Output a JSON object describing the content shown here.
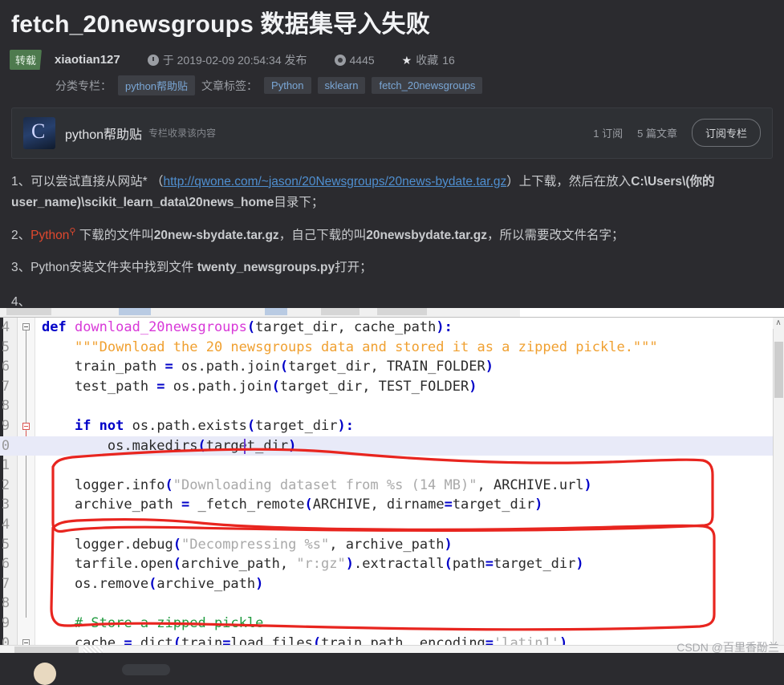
{
  "article": {
    "title": "fetch_20newsgroups 数据集导入失败",
    "repost_badge": "转载",
    "author": "xiaotian127",
    "publish_text": "于 2019-02-09 20:54:34 发布",
    "views": "4445",
    "favorite_label": "收藏",
    "favorite_count": "16",
    "category_label": "分类专栏：",
    "category": "python帮助贴",
    "tags_label": "文章标签：",
    "tags": [
      "Python",
      "sklearn",
      "fetch_20newsgroups"
    ],
    "icons": {
      "clock": "clock-icon",
      "eye": "eye-icon",
      "star": "★"
    }
  },
  "column_card": {
    "logo_letter": "C",
    "name": "python帮助贴",
    "subtitle": "专栏收录该内容",
    "subscribers": "1 订阅",
    "articles": "5 篇文章",
    "subscribe_button": "订阅专栏"
  },
  "body": {
    "p1": {
      "num": "1、",
      "before": "可以尝试直接从网站* （",
      "link": "http://qwone.com/~jason/20Newsgroups/20news-bydate.tar.gz",
      "after": "）上下载，然后在放入",
      "bold_tail": "C:\\Users\\(你的 user_name)\\scikit_learn_data\\20news_home",
      "end": "目录下；"
    },
    "p2": {
      "num": "2、",
      "red": "Python",
      "mag": "search-icon",
      "text_a": " 下载的文件叫",
      "bold_a": "20new-sbydate.tar.gz",
      "text_b": "，自己下载的叫",
      "bold_b": "20newsbydate.tar.gz",
      "text_c": "，所以需要改文件名字；"
    },
    "p3": {
      "num": "3、",
      "text_a": "Python安装文件夹中找到文件 ",
      "bold_a": "twenty_newsgroups.py",
      "text_b": "打开；"
    },
    "p4": {
      "num": "4、"
    }
  },
  "editor": {
    "watermark": "CSDN @百里香酚兰",
    "scroll_up_glyph": "∧",
    "lines": [
      {
        "num": "4",
        "segments": [
          {
            "t": "def ",
            "c": "kw"
          },
          {
            "t": "download_20newsgroups",
            "c": "fn"
          },
          {
            "t": "(",
            "c": "paren"
          },
          {
            "t": "target_dir, cache_path",
            "c": ""
          },
          {
            "t": ")",
            "c": "paren"
          },
          {
            "t": ":",
            "c": "paren"
          }
        ]
      },
      {
        "num": "5",
        "segments": [
          {
            "t": "    ",
            "c": ""
          },
          {
            "t": "\"\"\"Download the 20 newsgroups data and stored it as a zipped pickle.\"\"\"",
            "c": "str"
          }
        ]
      },
      {
        "num": "6",
        "segments": [
          {
            "t": "    train_path ",
            "c": ""
          },
          {
            "t": "=",
            "c": "paren"
          },
          {
            "t": " os.path.join",
            "c": ""
          },
          {
            "t": "(",
            "c": "paren"
          },
          {
            "t": "target_dir, TRAIN_FOLDER",
            "c": ""
          },
          {
            "t": ")",
            "c": "paren"
          }
        ]
      },
      {
        "num": "7",
        "segments": [
          {
            "t": "    test_path ",
            "c": ""
          },
          {
            "t": "=",
            "c": "paren"
          },
          {
            "t": " os.path.join",
            "c": ""
          },
          {
            "t": "(",
            "c": "paren"
          },
          {
            "t": "target_dir, TEST_FOLDER",
            "c": ""
          },
          {
            "t": ")",
            "c": "paren"
          }
        ]
      },
      {
        "num": "8",
        "segments": []
      },
      {
        "num": "9",
        "segments": [
          {
            "t": "    ",
            "c": ""
          },
          {
            "t": "if not",
            "c": "kw"
          },
          {
            "t": " os.path.exists",
            "c": ""
          },
          {
            "t": "(",
            "c": "paren"
          },
          {
            "t": "target_dir",
            "c": ""
          },
          {
            "t": ")",
            "c": "paren"
          },
          {
            "t": ":",
            "c": "paren"
          }
        ]
      },
      {
        "num": "0",
        "hl": true,
        "segments": [
          {
            "t": "        os.makedirs",
            "c": ""
          },
          {
            "t": "(",
            "c": "paren"
          },
          {
            "t": "target_dir",
            "c": ""
          },
          {
            "t": ")",
            "c": "paren"
          }
        ]
      },
      {
        "num": "1",
        "segments": []
      },
      {
        "num": "2",
        "segments": [
          {
            "t": "    logger.info",
            "c": ""
          },
          {
            "t": "(",
            "c": "paren"
          },
          {
            "t": "\"Downloading dataset from %s (14 MB)\"",
            "c": "str2"
          },
          {
            "t": ", ARCHIVE.url",
            "c": ""
          },
          {
            "t": ")",
            "c": "paren"
          }
        ]
      },
      {
        "num": "3",
        "segments": [
          {
            "t": "    archive_path ",
            "c": ""
          },
          {
            "t": "=",
            "c": "paren"
          },
          {
            "t": " _fetch_remote",
            "c": ""
          },
          {
            "t": "(",
            "c": "paren"
          },
          {
            "t": "ARCHIVE, dirname",
            "c": ""
          },
          {
            "t": "=",
            "c": "paren"
          },
          {
            "t": "target_dir",
            "c": ""
          },
          {
            "t": ")",
            "c": "paren"
          }
        ]
      },
      {
        "num": "4",
        "segments": []
      },
      {
        "num": "5",
        "segments": [
          {
            "t": "    logger.debug",
            "c": ""
          },
          {
            "t": "(",
            "c": "paren"
          },
          {
            "t": "\"Decompressing %s\"",
            "c": "str2"
          },
          {
            "t": ", archive_path",
            "c": ""
          },
          {
            "t": ")",
            "c": "paren"
          }
        ]
      },
      {
        "num": "6",
        "segments": [
          {
            "t": "    tarfile.open",
            "c": ""
          },
          {
            "t": "(",
            "c": "paren"
          },
          {
            "t": "archive_path, ",
            "c": ""
          },
          {
            "t": "\"r:gz\"",
            "c": "str2"
          },
          {
            "t": ")",
            "c": "paren"
          },
          {
            "t": ".extractall",
            "c": ""
          },
          {
            "t": "(",
            "c": "paren"
          },
          {
            "t": "path",
            "c": ""
          },
          {
            "t": "=",
            "c": "paren"
          },
          {
            "t": "target_dir",
            "c": ""
          },
          {
            "t": ")",
            "c": "paren"
          }
        ]
      },
      {
        "num": "7",
        "segments": [
          {
            "t": "    os.remove",
            "c": ""
          },
          {
            "t": "(",
            "c": "paren"
          },
          {
            "t": "archive_path",
            "c": ""
          },
          {
            "t": ")",
            "c": "paren"
          }
        ]
      },
      {
        "num": "8",
        "segments": []
      },
      {
        "num": "9",
        "segments": [
          {
            "t": "    ",
            "c": ""
          },
          {
            "t": "# Store a zipped pickle",
            "c": "cmt"
          }
        ]
      },
      {
        "num": "0",
        "segments": [
          {
            "t": "    cache ",
            "c": ""
          },
          {
            "t": "=",
            "c": "paren"
          },
          {
            "t": " dict",
            "c": ""
          },
          {
            "t": "(",
            "c": "paren"
          },
          {
            "t": "train",
            "c": ""
          },
          {
            "t": "=",
            "c": "paren"
          },
          {
            "t": "load_files",
            "c": ""
          },
          {
            "t": "(",
            "c": "paren"
          },
          {
            "t": "train_path, encoding",
            "c": ""
          },
          {
            "t": "=",
            "c": "paren"
          },
          {
            "t": "'latin1'",
            "c": "str2"
          },
          {
            "t": ")",
            "c": "paren"
          },
          {
            "t": ",",
            "c": ""
          }
        ]
      }
    ]
  },
  "colors": {
    "page_bg": "#2b2b2f",
    "accent_link": "#4f8fd0",
    "badge_green": "#4e7a4e",
    "annotation_red": "#e8251f",
    "code_keyword": "#0000c8",
    "code_function": "#d838d8",
    "code_string": "#f0a030",
    "code_comment": "#1f9b3f"
  }
}
